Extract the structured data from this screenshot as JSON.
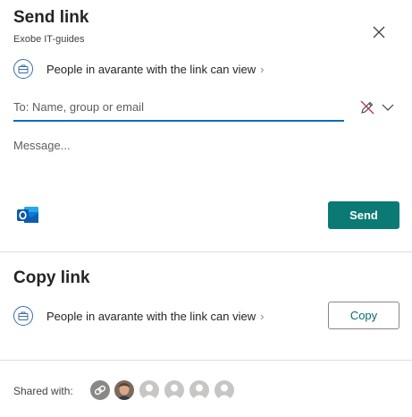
{
  "send": {
    "title": "Send link",
    "subtitle": "Exobe IT-guides",
    "permission_text": "People in avarante with the link can view",
    "to_placeholder": "To: Name, group or email",
    "message_placeholder": "Message...",
    "send_label": "Send"
  },
  "copy": {
    "title": "Copy link",
    "permission_text": "People in avarante with the link can view",
    "copy_label": "Copy"
  },
  "shared": {
    "label": "Shared with:"
  },
  "colors": {
    "accent": "#0b7a75",
    "link_blue": "#0f6cbd"
  },
  "icons": {
    "close": "close-icon",
    "permission": "briefcase-icon",
    "chevron": "chevron-right-icon",
    "pencil": "pencil-off-icon",
    "dropdown": "chevron-down-icon",
    "outlook": "outlook-icon",
    "link": "link-icon"
  }
}
